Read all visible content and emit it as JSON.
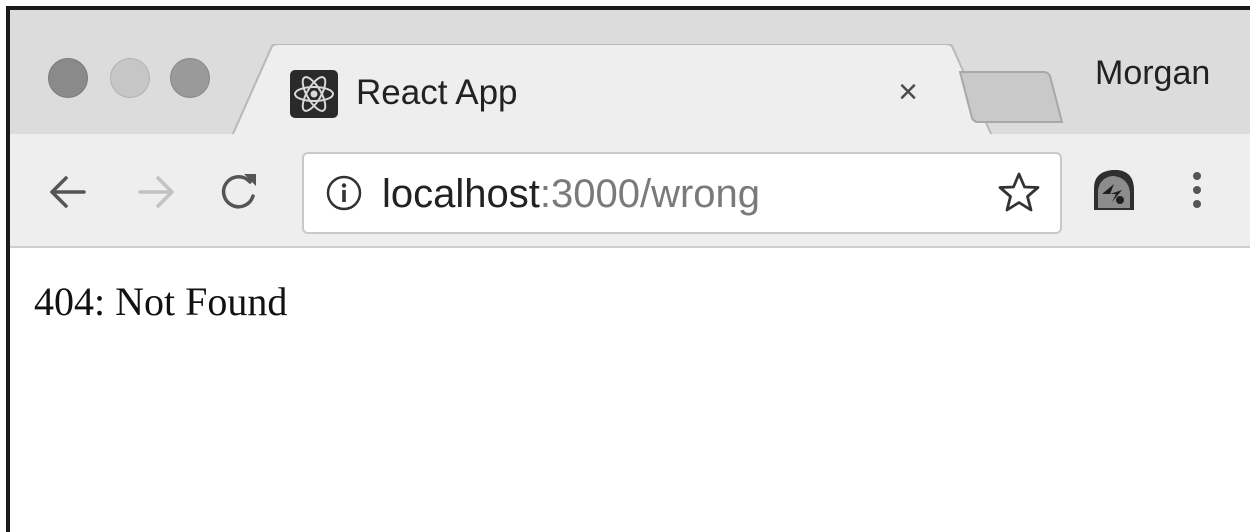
{
  "window": {
    "controls": [
      "close",
      "minimize",
      "zoom"
    ]
  },
  "tab": {
    "title": "React App",
    "favicon": "react-logo-icon",
    "close_glyph": "×"
  },
  "profile": {
    "name": "Morgan"
  },
  "toolbar": {
    "back_icon": "arrow-left-icon",
    "forward_icon": "arrow-right-icon",
    "reload_icon": "reload-icon",
    "omnibox": {
      "host": "localhost",
      "rest": ":3000/wrong",
      "info_icon": "info-icon",
      "bookmark_icon": "star-icon"
    },
    "extension_icon": "extension-icon",
    "menu_icon": "kebab-menu-icon"
  },
  "page": {
    "body_text": "404: Not Found"
  },
  "colors": {
    "tabstrip": "#dcdcdc",
    "toolbar": "#eeeeee",
    "active_tab": "#eeeeee",
    "page_bg": "#ffffff"
  }
}
